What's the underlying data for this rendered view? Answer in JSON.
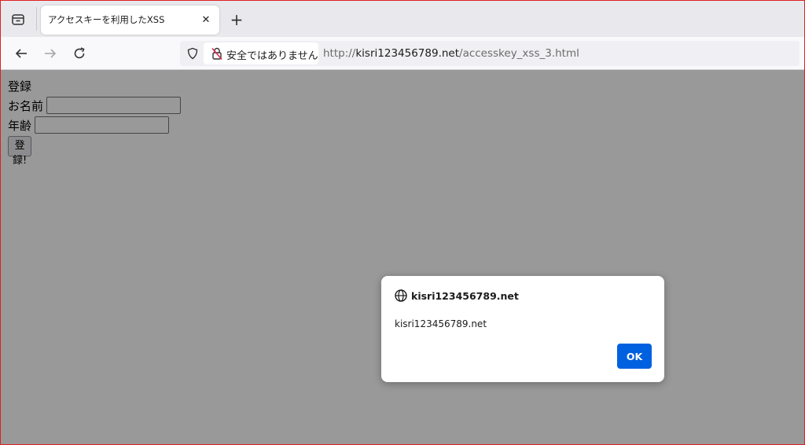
{
  "browser": {
    "tab": {
      "title": "アクセスキーを利用したXSS",
      "close_glyph": "✕"
    },
    "new_tab_glyph": "+",
    "security": {
      "label": "安全ではありません"
    },
    "url": {
      "scheme": "http://",
      "host": "kisri123456789.net",
      "path": "/accesskey_xss_3.html"
    }
  },
  "page": {
    "title": "登録",
    "fields": [
      {
        "label": "お名前",
        "value": ""
      },
      {
        "label": "年齢",
        "value": ""
      }
    ],
    "submit_label": "登録!"
  },
  "dialog": {
    "origin": "kisri123456789.net",
    "message": "kisri123456789.net",
    "ok_label": "OK",
    "ok_color": "#0061e0"
  },
  "icons": [
    "tab-list-icon",
    "close-icon",
    "plus-icon",
    "back-arrow-icon",
    "forward-arrow-icon",
    "reload-icon",
    "shield-icon",
    "insecure-lock-icon",
    "globe-icon"
  ],
  "colors": {
    "overlay": "#999999",
    "frame_border": "#e02020"
  }
}
